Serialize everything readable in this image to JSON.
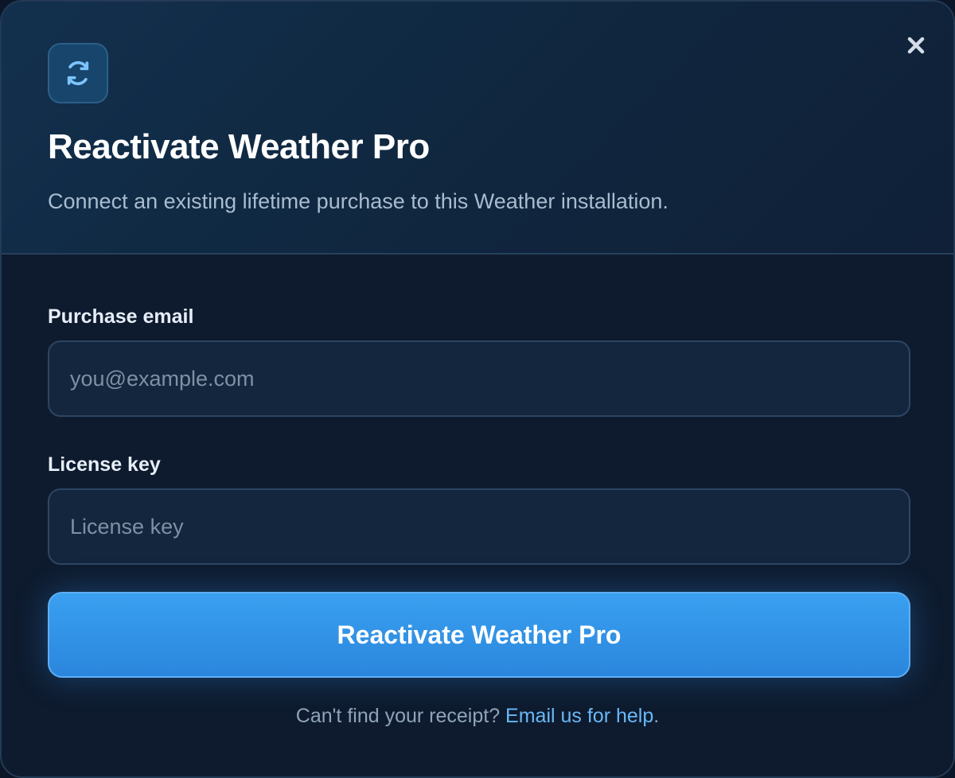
{
  "dialog": {
    "title": "Reactivate Weather Pro",
    "subtitle": "Connect an existing lifetime purchase to this Weather installation.",
    "header_icon": "refresh-icon",
    "close_icon": "close-icon"
  },
  "form": {
    "email_label": "Purchase email",
    "email_placeholder": "you@example.com",
    "email_value": "",
    "license_label": "License key",
    "license_placeholder": "License key",
    "license_value": "",
    "submit_label": "Reactivate Weather Pro"
  },
  "footer": {
    "text": "Can't find your receipt?",
    "link_text": "Email us for help",
    "trailing": "."
  },
  "colors": {
    "accent": "#3a9bef",
    "link": "#6ab8f7",
    "background": "#0e1b2e"
  }
}
